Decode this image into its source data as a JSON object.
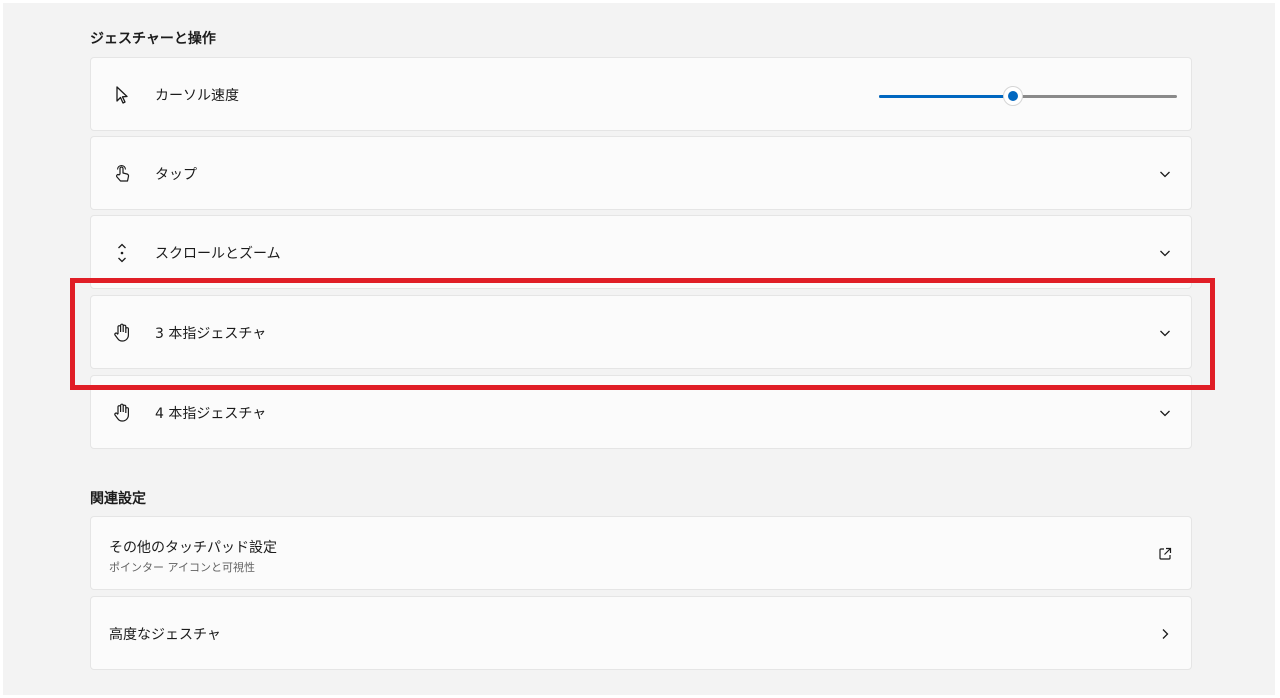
{
  "gestures_section": {
    "title": "ジェスチャーと操作",
    "items": [
      {
        "label": "カーソル速度",
        "icon": "cursor-arrow-icon",
        "control": "slider"
      },
      {
        "label": "タップ",
        "icon": "tap-hand-icon",
        "control": "chevron-down"
      },
      {
        "label": "スクロールとズーム",
        "icon": "scroll-arrows-icon",
        "control": "chevron-down"
      },
      {
        "label": "3 本指ジェスチャ",
        "icon": "hand-gesture-icon",
        "control": "chevron-down"
      },
      {
        "label": "4 本指ジェスチャ",
        "icon": "hand-gesture-icon",
        "control": "chevron-down"
      }
    ],
    "cursor_speed_fraction": 0.45
  },
  "related_section": {
    "title": "関連設定",
    "items": [
      {
        "label": "その他のタッチパッド設定",
        "sublabel": "ポインター アイコンと可視性",
        "icon": "open-external-icon"
      },
      {
        "label": "高度なジェスチャ",
        "icon": "chevron-right-icon"
      }
    ]
  },
  "colors": {
    "accent": "#0067c0",
    "highlight": "#e01e26",
    "background": "#f3f3f3",
    "card": "#fbfbfb"
  }
}
